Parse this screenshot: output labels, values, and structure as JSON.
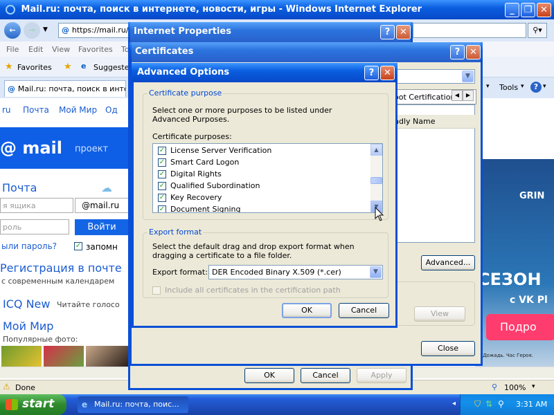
{
  "ie": {
    "title": "Mail.ru: почта, поиск в интернете, новости, игры - Windows Internet Explorer",
    "address": "https://mail.ru/",
    "menu": [
      "File",
      "Edit",
      "View",
      "Favorites",
      "To"
    ],
    "favorites_label": "Favorites",
    "suggested_label": "Suggested",
    "tab_label": "Mail.ru: почта, поиск в инте",
    "tools_label": "Tools",
    "status_done": "Done",
    "zoom": "100%",
    "page": {
      "nav": [
        "ru",
        "Почта",
        "Мой Мир",
        "Од"
      ],
      "logo_text": "@ mail",
      "project_text": "проект",
      "pochta_heading": "Почта",
      "login_placeholder": "я ящика",
      "domain": "@mail.ru",
      "password_placeholder": "роль",
      "login_button": "Войти",
      "forgot_password": "ыли пароль?",
      "remember": "запомн",
      "register_heading": "Регистрация в почте",
      "register_sub": "с современным календарем",
      "icq_heading": "ICQ New",
      "icq_sub": "Читайте голосо",
      "moymir_heading": "Мой Мир",
      "moymir_sub": "Популярные фото:",
      "ad_text1": "СЕЗОН",
      "ad_text2": "с VK Pl",
      "ad_button": "Подро",
      "ad_small": "ир Дожадь. Час Героя.",
      "ad_game": "GRIN"
    }
  },
  "internet_properties": {
    "title": "Internet Properties",
    "ok": "OK",
    "cancel": "Cancel",
    "apply": "Apply"
  },
  "certificates": {
    "title": "Certificates",
    "tab_partial": "oot Certification",
    "column_friendly": "ndly Name",
    "advanced_button": "Advanced...",
    "view_button": "View",
    "close_button": "Close"
  },
  "advanced_options": {
    "title": "Advanced Options",
    "purpose_group": "Certificate purpose",
    "purpose_desc": "Select one or more purposes to be listed under Advanced Purposes.",
    "purposes_label": "Certificate purposes:",
    "purposes": [
      {
        "label": "License Server Verification",
        "checked": true
      },
      {
        "label": "Smart Card Logon",
        "checked": true
      },
      {
        "label": "Digital Rights",
        "checked": true
      },
      {
        "label": "Qualified Subordination",
        "checked": true
      },
      {
        "label": "Key Recovery",
        "checked": true
      },
      {
        "label": "Document Signing",
        "checked": true
      }
    ],
    "export_group": "Export format",
    "export_desc": "Select the default drag and drop export format when dragging a certificate to a file folder.",
    "export_label": "Export format:",
    "export_value": "DER Encoded Binary X.509 (*.cer)",
    "include_all": "Include all certificates in the certification path",
    "ok": "OK",
    "cancel": "Cancel"
  },
  "taskbar": {
    "start": "start",
    "task": "Mail.ru: почта, поис...",
    "clock": "3:31 AM"
  }
}
